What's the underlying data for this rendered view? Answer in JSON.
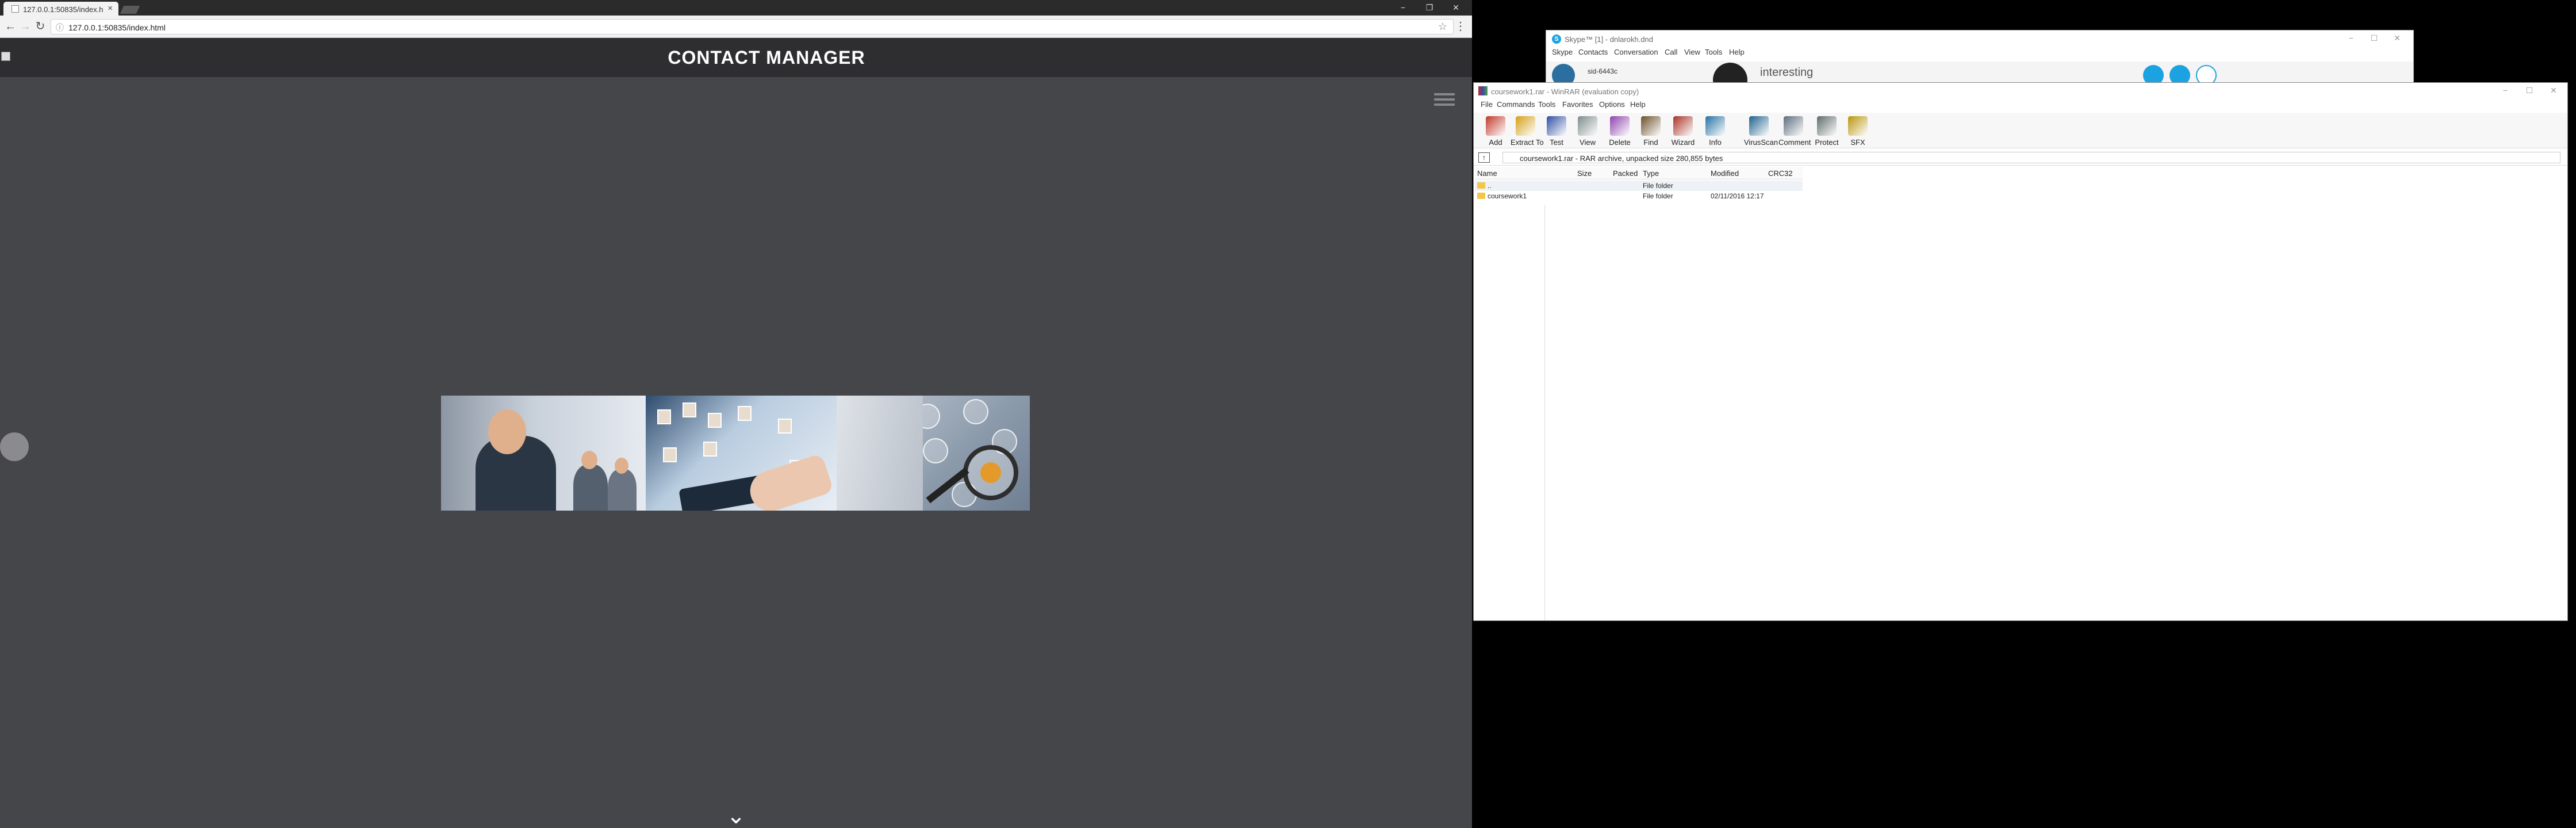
{
  "chrome": {
    "tab_title": "127.0.0.1:50835/index.h",
    "tab_close": "×",
    "url": "127.0.0.1:50835/index.html",
    "controls": {
      "min": "−",
      "max": "❐",
      "close": "✕"
    }
  },
  "site": {
    "title": "CONTACT MANAGER",
    "scroll_down": "⌄"
  },
  "skype": {
    "title": "Skype™ [1] - dnlarokh.dnd",
    "logo": "S",
    "menu": [
      "Skype",
      "Contacts",
      "Conversation",
      "Call",
      "View",
      "Tools",
      "Help"
    ],
    "user": "sid-6443c",
    "status": "interesting"
  },
  "winrar": {
    "title": "coursework1.rar - WinRAR (evaluation copy)",
    "menu": [
      "File",
      "Commands",
      "Tools",
      "Favorites",
      "Options",
      "Help"
    ],
    "toolbar": [
      {
        "label": "Add",
        "icon": "add-icon",
        "color": "#c0392b"
      },
      {
        "label": "Extract To",
        "icon": "extract-icon",
        "color": "#d4a017"
      },
      {
        "label": "Test",
        "icon": "test-icon",
        "color": "#2e4fa3"
      },
      {
        "label": "View",
        "icon": "view-icon",
        "color": "#7f8c8d"
      },
      {
        "label": "Delete",
        "icon": "delete-icon",
        "color": "#8e44ad"
      },
      {
        "label": "Find",
        "icon": "find-icon",
        "color": "#6b4f2a"
      },
      {
        "label": "Wizard",
        "icon": "wizard-icon",
        "color": "#a93226"
      },
      {
        "label": "Info",
        "icon": "info-icon",
        "color": "#2471a3"
      },
      {
        "label": "VirusScan",
        "icon": "virusscan-icon",
        "color": "#1f618d"
      },
      {
        "label": "Comment",
        "icon": "comment-icon",
        "color": "#5d6d7e"
      },
      {
        "label": "Protect",
        "icon": "protect-icon",
        "color": "#5f6a6a"
      },
      {
        "label": "SFX",
        "icon": "sfx-icon",
        "color": "#b7950b"
      }
    ],
    "path_text": "coursework1.rar - RAR archive, unpacked size 280,855 bytes",
    "columns": [
      "Name",
      "Size",
      "Packed",
      "Type",
      "Modified",
      "CRC32"
    ],
    "rows": [
      {
        "name": "..",
        "size": "",
        "packed": "",
        "type": "File folder",
        "modified": "",
        "crc": ""
      },
      {
        "name": "coursework1",
        "size": "",
        "packed": "",
        "type": "File folder",
        "modified": "02/11/2016 12:17",
        "crc": ""
      }
    ]
  }
}
